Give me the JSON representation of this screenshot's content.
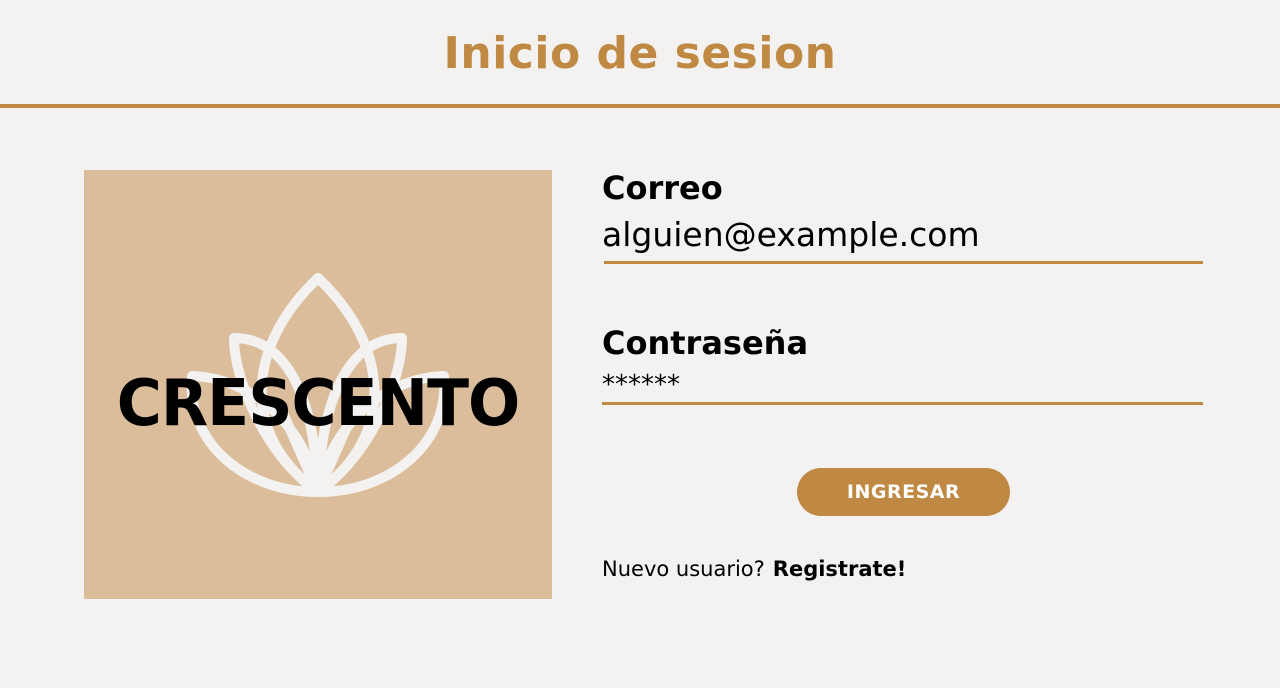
{
  "header": {
    "title": "Inicio de sesion"
  },
  "logo": {
    "text": "CRESCENTO",
    "background_color": "#dbbd9b",
    "icon": "lotus-icon"
  },
  "form": {
    "email": {
      "label": "Correo",
      "value": "alguien@example.com"
    },
    "password": {
      "label": "Contraseña",
      "value": "******"
    },
    "submit_label": "INGRESAR"
  },
  "register": {
    "prompt": "Nuevo usuario?",
    "link": "Registrate!"
  },
  "colors": {
    "accent": "#bf8943",
    "background": "#f4f2f0",
    "text": "#000000"
  }
}
